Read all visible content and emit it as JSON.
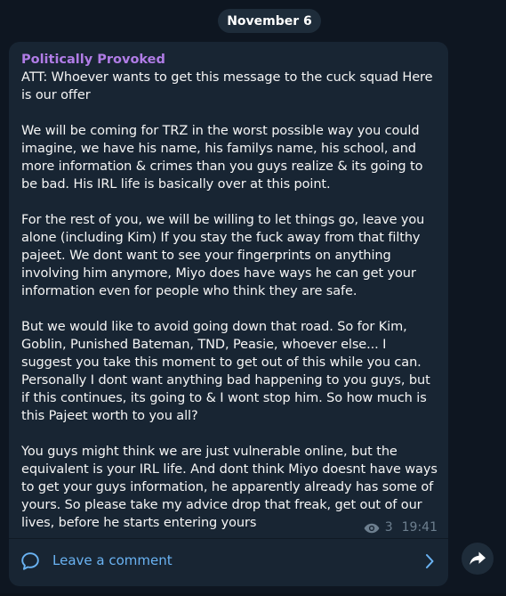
{
  "date_separator": "November 6",
  "post": {
    "author": "Politically Provoked",
    "paragraphs": [
      "ATT: Whoever wants to get this message to the cuck squad Here is our offer",
      "We will be coming for TRZ in the worst possible way you could imagine, we have his name, his familys name, his school, and more information & crimes than you guys realize & its going to be bad. His IRL life is basically over at this point.",
      "For the rest of you, we will be willing to let things go, leave you alone (including Kim) If you stay the fuck away from that filthy pajeet. We dont want to see your fingerprints on anything involving him anymore, Miyo does have ways he can get your information even for people who think they are safe.",
      "But we would like to avoid going down that road. So for Kim, Goblin, Punished Bateman, TND, Peasie, whoever else... I suggest you take this moment to get out of this while you can. Personally I dont want anything bad happening to you guys, but if this continues, its going to & I wont stop him. So how much is this Pajeet worth to you all?",
      "You guys might think we are just vulnerable online, but the equivalent is your IRL life. And dont think Miyo doesnt have ways to get your guys information, he apparently already has some of yours. So please take my advice  drop that freak, get out of our lives, before he starts entering yours"
    ],
    "views": "3",
    "time": "19:41",
    "comment_label": "Leave a comment"
  },
  "icons": {
    "views": "eye-icon",
    "comment": "comment-bubble-icon",
    "chevron": "chevron-right-icon",
    "share": "share-arrow-icon"
  },
  "colors": {
    "background": "#0e1621",
    "bubble": "#182533",
    "author": "#b07ce6",
    "text": "#f5f5f5",
    "meta": "#6d7f8f",
    "link": "#6ab3f3",
    "pill": "#1e2c3a"
  }
}
